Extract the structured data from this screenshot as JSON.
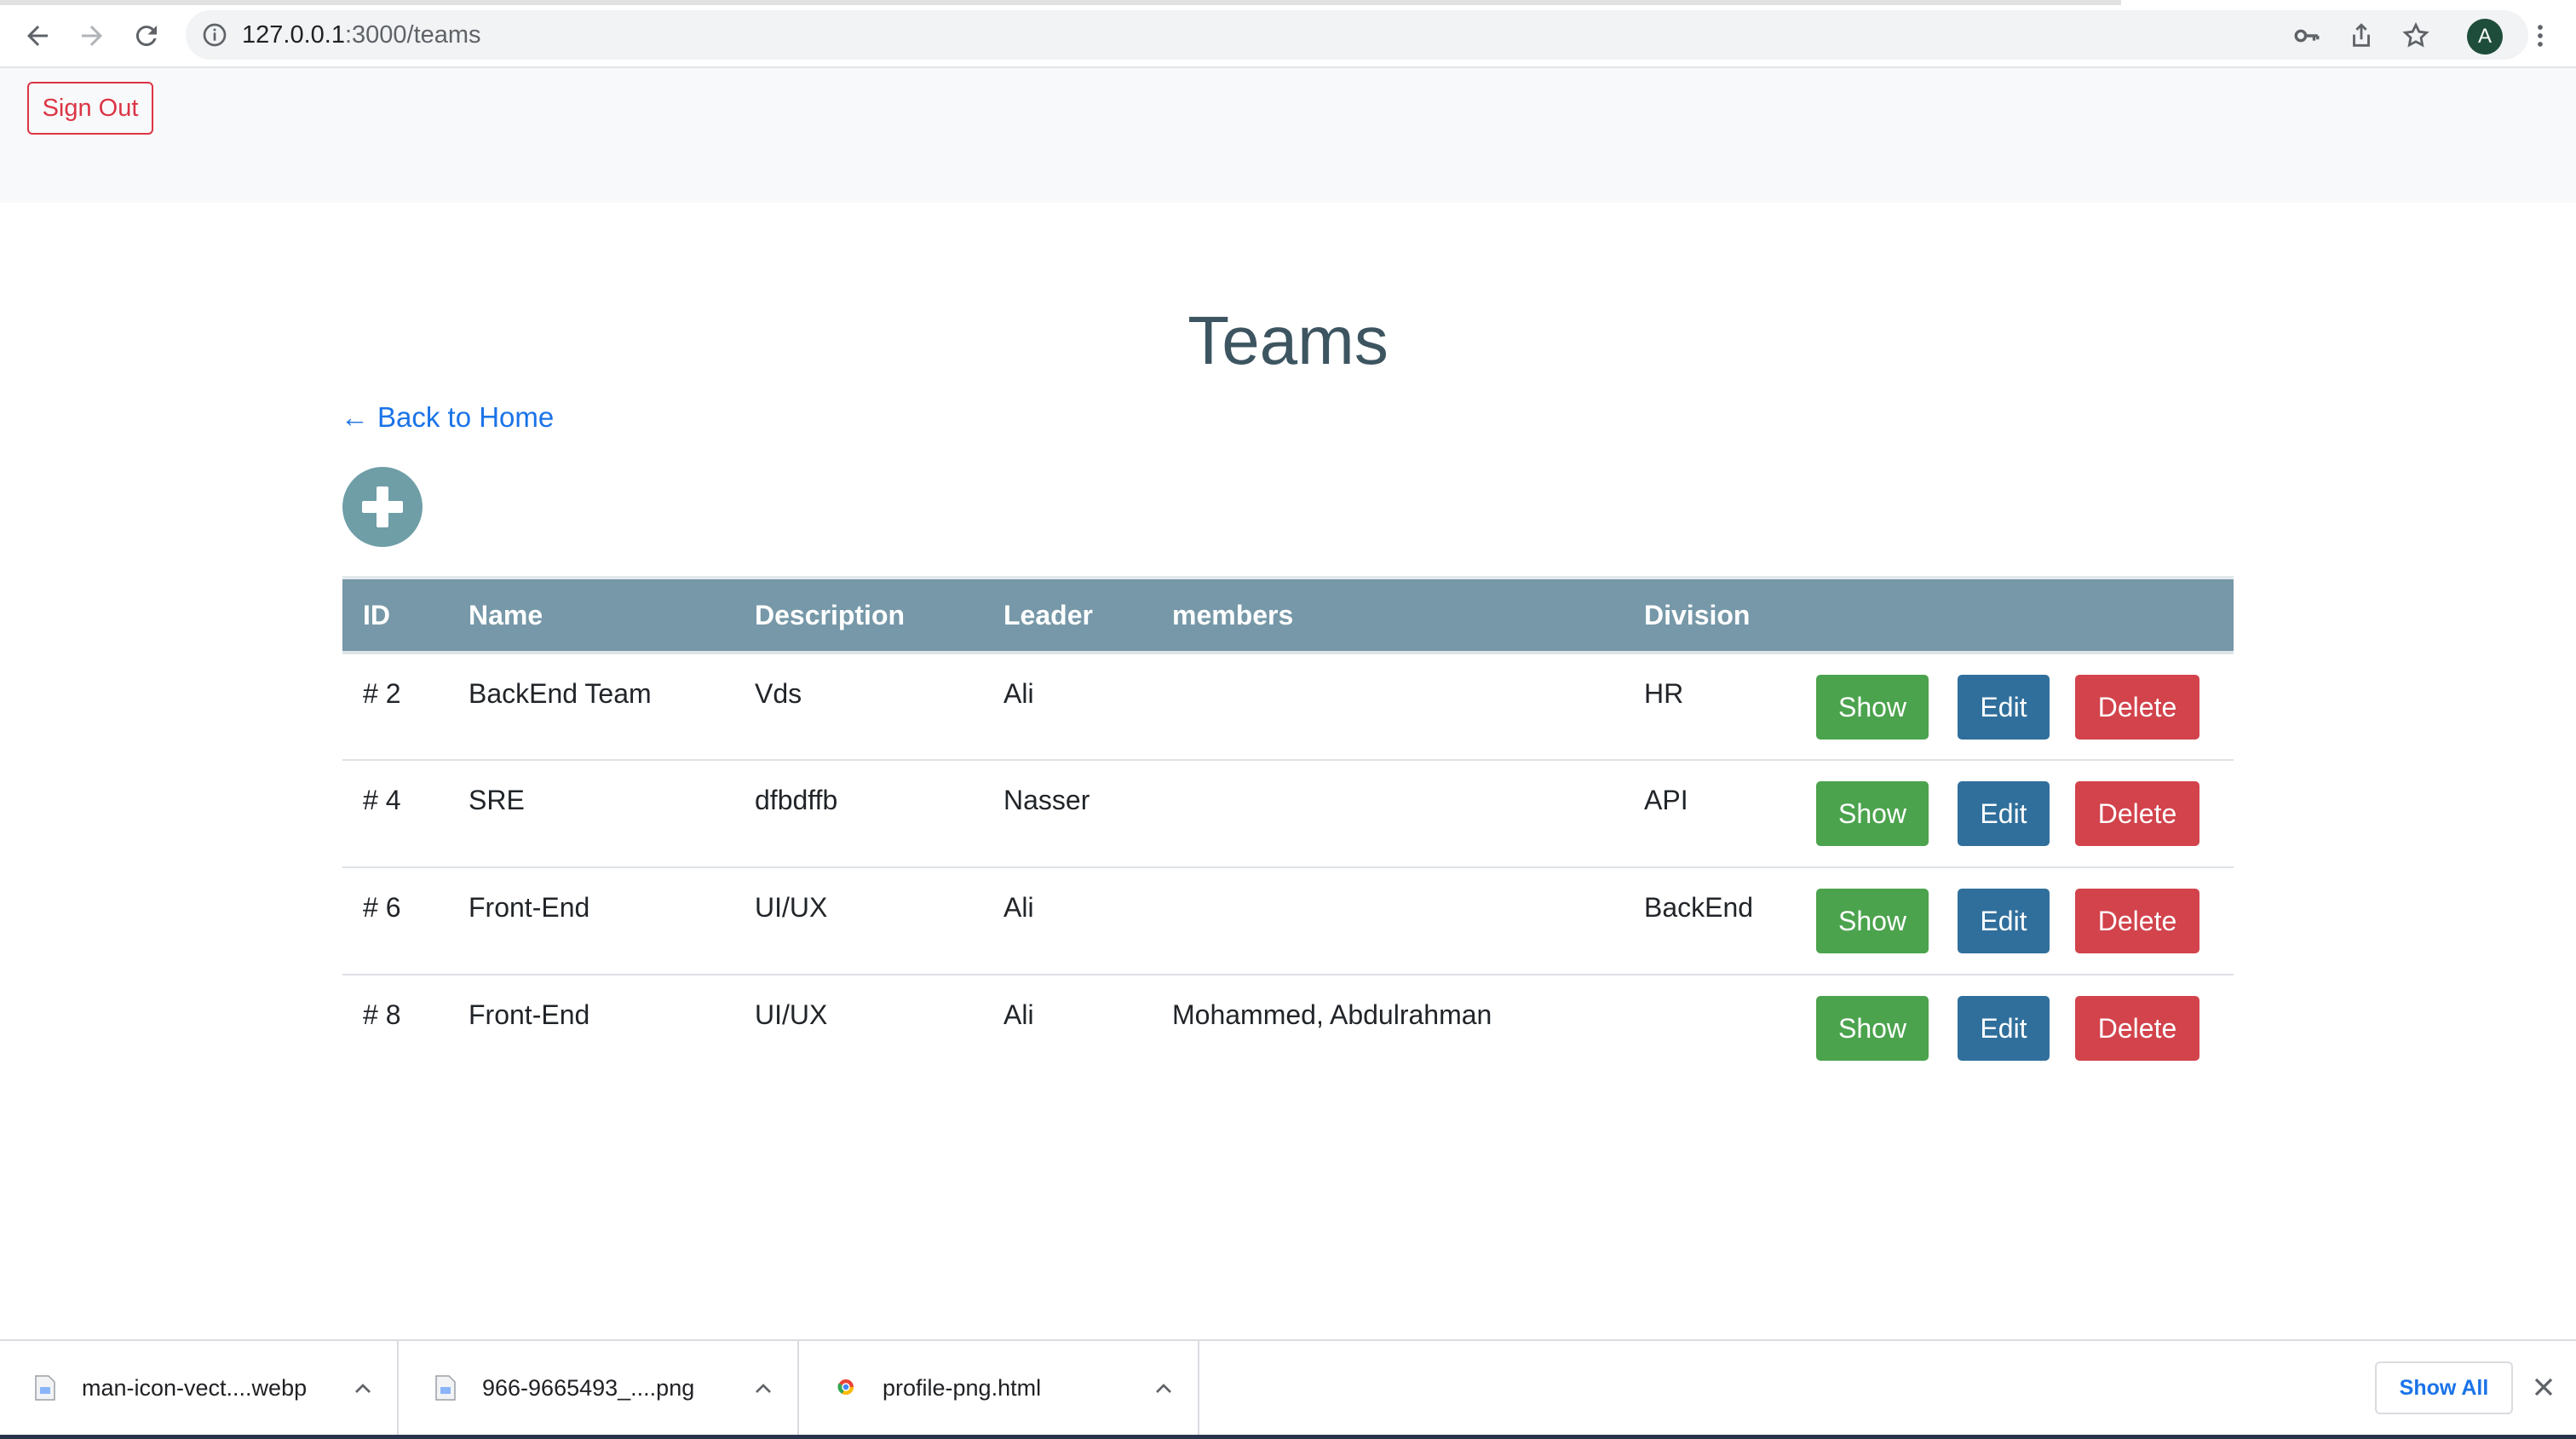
{
  "browser": {
    "url_host": "127.0.0.1",
    "url_path": ":3000/teams",
    "avatar_letter": "A"
  },
  "header": {
    "sign_out_label": "Sign Out"
  },
  "main": {
    "title": "Teams",
    "back_link": "Back to Home",
    "back_arrow": "←"
  },
  "table": {
    "columns": [
      "ID",
      "Name",
      "Description",
      "Leader",
      "members",
      "Division",
      ""
    ],
    "rows": [
      {
        "id": "# 2",
        "name": "BackEnd Team",
        "description": "Vds",
        "leader": "Ali",
        "members": "",
        "division": "HR"
      },
      {
        "id": "# 4",
        "name": "SRE",
        "description": "dfbdffb",
        "leader": "Nasser",
        "members": "",
        "division": "API"
      },
      {
        "id": "# 6",
        "name": "Front-End",
        "description": "UI/UX",
        "leader": "Ali",
        "members": "",
        "division": "BackEnd"
      },
      {
        "id": "# 8",
        "name": "Front-End",
        "description": "UI/UX",
        "leader": "Ali",
        "members": "Mohammed, Abdulrahman",
        "division": ""
      }
    ],
    "actions": {
      "show": "Show",
      "edit": "Edit",
      "delete": "Delete"
    }
  },
  "downloads": {
    "items": [
      {
        "name": "man-icon-vect....webp"
      },
      {
        "name": "966-9665493_....png"
      },
      {
        "name": "profile-png.html"
      }
    ],
    "show_all": "Show All"
  },
  "colors": {
    "header_bg": "#f8f9fa",
    "table_head": "#7698a8",
    "show": "#4ba34d",
    "edit": "#306f9c",
    "delete": "#d2434c",
    "link": "#1a73e8",
    "add_button": "#6f9ea7"
  },
  "icons": [
    "back-arrow-icon",
    "forward-arrow-icon",
    "reload-icon",
    "info-icon",
    "key-icon",
    "share-icon",
    "star-icon",
    "kebab-menu-icon",
    "plus-circle-icon",
    "file-icon",
    "chevron-up-icon",
    "close-icon"
  ]
}
